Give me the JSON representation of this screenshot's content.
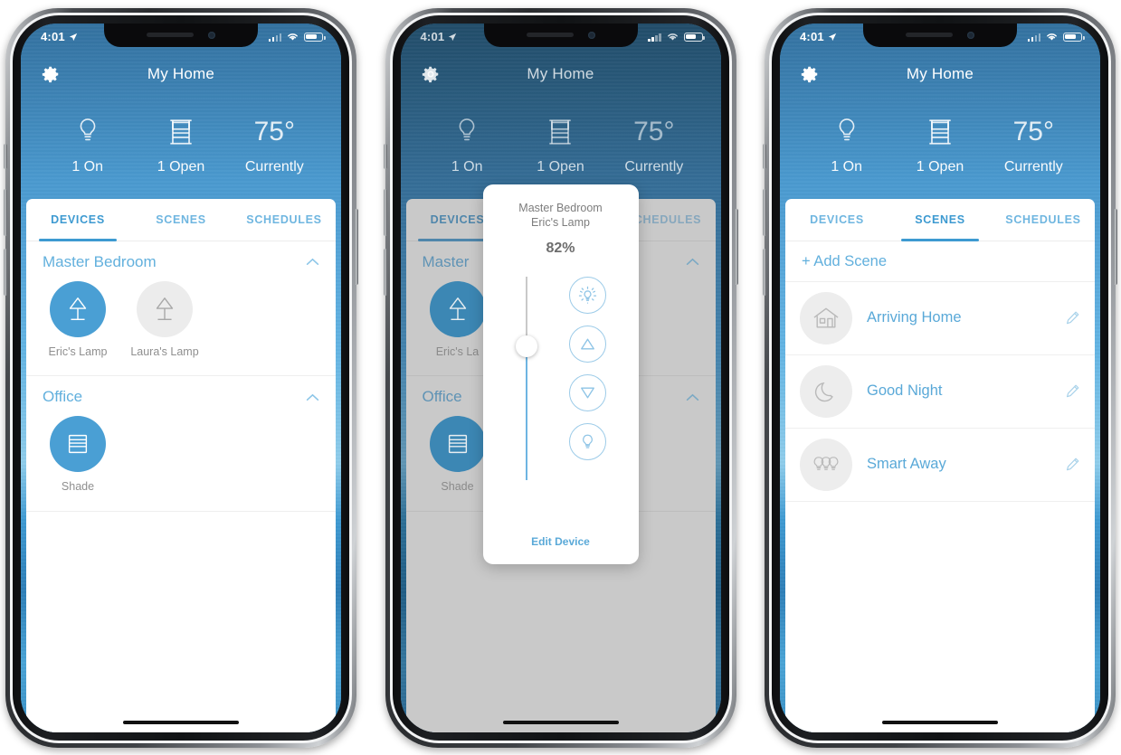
{
  "status_bar": {
    "time": "4:01",
    "location_icon": "location-arrow-icon",
    "signal_icon": "cellular-signal-icon",
    "wifi_icon": "wifi-icon",
    "battery_icon": "battery-icon"
  },
  "header": {
    "settings_icon": "gear-icon",
    "title": "My Home",
    "stats": [
      {
        "icon": "lightbulb-icon",
        "label": "1 On"
      },
      {
        "icon": "window-shade-icon",
        "label": "1 Open"
      },
      {
        "value": "75°",
        "label": "Currently"
      }
    ]
  },
  "tabs": [
    {
      "label": "DEVICES"
    },
    {
      "label": "SCENES"
    },
    {
      "label": "SCHEDULES"
    }
  ],
  "phone1": {
    "active_tab": "DEVICES",
    "sections": [
      {
        "title": "Master Bedroom",
        "collapse_icon": "chevron-up-icon",
        "devices": [
          {
            "name": "Eric's Lamp",
            "icon": "table-lamp-icon",
            "state": "on"
          },
          {
            "name": "Laura's Lamp",
            "icon": "table-lamp-icon",
            "state": "off"
          }
        ]
      },
      {
        "title": "Office",
        "collapse_icon": "chevron-up-icon",
        "devices": [
          {
            "name": "Shade",
            "icon": "shade-icon",
            "state": "on"
          }
        ]
      }
    ]
  },
  "phone2": {
    "active_tab": "DEVICES",
    "sections": [
      {
        "title": "Master",
        "collapse_icon": "chevron-up-icon",
        "devices": [
          {
            "name": "Eric's La",
            "icon": "table-lamp-icon",
            "state": "on"
          }
        ]
      },
      {
        "title": "Office",
        "collapse_icon": "chevron-up-icon",
        "devices": [
          {
            "name": "Shade",
            "icon": "shade-icon",
            "state": "on"
          }
        ]
      }
    ],
    "modal": {
      "room": "Master Bedroom",
      "device": "Eric's Lamp",
      "percent": "82%",
      "slider_value": 82,
      "buttons": [
        {
          "icon": "brightness-full-icon",
          "name": "full-brightness-button"
        },
        {
          "icon": "triangle-up-icon",
          "name": "brightness-up-button"
        },
        {
          "icon": "triangle-down-icon",
          "name": "brightness-down-button"
        },
        {
          "icon": "bulb-off-icon",
          "name": "bulb-off-button"
        }
      ],
      "edit_label": "Edit Device"
    }
  },
  "phone3": {
    "active_tab": "SCENES",
    "add_scene_label": "+ Add Scene",
    "scenes": [
      {
        "name": "Arriving Home",
        "icon": "house-icon",
        "edit_icon": "pencil-icon"
      },
      {
        "name": "Good Night",
        "icon": "moon-icon",
        "edit_icon": "pencil-icon"
      },
      {
        "name": "Smart Away",
        "icon": "three-bulbs-icon",
        "edit_icon": "pencil-icon"
      }
    ]
  },
  "colors": {
    "accent_blue": "#4a9fd4",
    "tab_blue": "#3d9ad1",
    "light_blue": "#6eb5e2",
    "header_top": "#3d87be",
    "header_bottom": "#63b4e3",
    "off_gray": "#ececec",
    "text_gray": "#8f8f8f"
  }
}
